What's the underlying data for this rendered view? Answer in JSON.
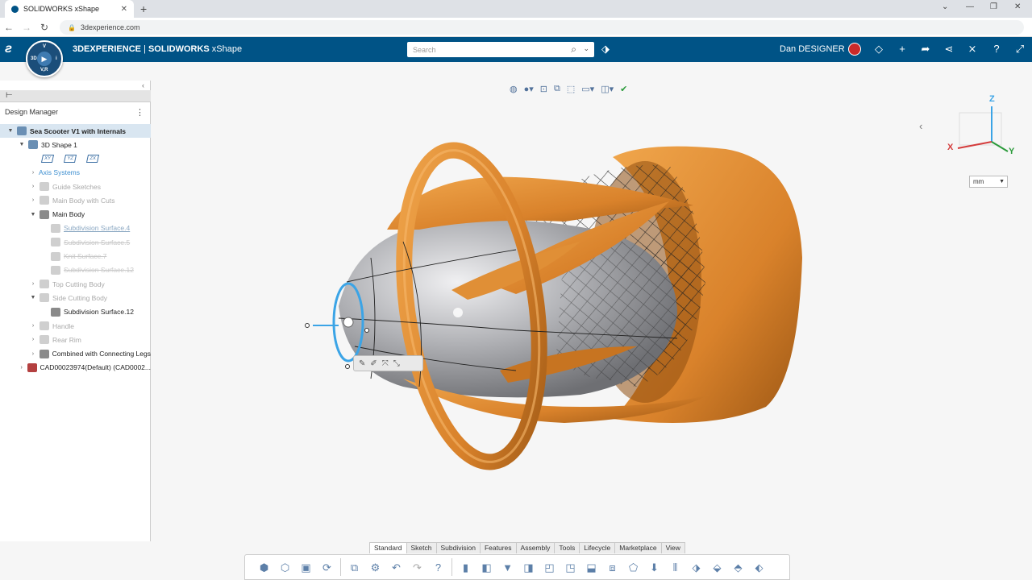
{
  "browser": {
    "tab_title": "SOLIDWORKS xShape",
    "tab_close": "✕",
    "new_tab": "+",
    "url": "3dexperience.com",
    "window_controls": [
      "⌄",
      "—",
      "❐",
      "✕"
    ]
  },
  "header": {
    "brand": "3DEXPERIENCE",
    "separator": " | ",
    "product": "SOLIDWORKS",
    "app": " xShape",
    "compass_quadrants": [
      "3D",
      "V",
      "i",
      "V,R"
    ],
    "search_placeholder": "Search",
    "user_name": "Dan DESIGNER",
    "icons": [
      "tag-icon",
      "add-icon",
      "share-icon",
      "network-icon",
      "compass-icon",
      "help-icon",
      "fullscreen-icon"
    ]
  },
  "design_manager": {
    "title": "Design Manager",
    "tree": [
      {
        "label": "Sea Scooter V1 with Internals",
        "style": "b",
        "depth": 0,
        "arrow": "▼",
        "icon": "blue",
        "selected": true
      },
      {
        "label": "3D Shape 1",
        "style": "",
        "depth": 1,
        "arrow": "▼",
        "icon": "blue"
      },
      {
        "label": "Axis Systems",
        "style": "link",
        "depth": 2,
        "arrow": "›",
        "icon": ""
      },
      {
        "label": "Guide Sketches",
        "style": "dim",
        "depth": 2,
        "arrow": "›",
        "icon": "light"
      },
      {
        "label": "Main Body with Cuts",
        "style": "dim",
        "depth": 2,
        "arrow": "›",
        "icon": "light"
      },
      {
        "label": "Main Body",
        "style": "",
        "depth": 2,
        "arrow": "▼",
        "icon": "gray"
      },
      {
        "label": "Subdivision Surface.4",
        "style": "ul",
        "depth": 3,
        "arrow": "",
        "icon": "light"
      },
      {
        "label": "Subdivision Surface.5",
        "style": "faint",
        "depth": 3,
        "arrow": "",
        "icon": "light"
      },
      {
        "label": "Knit Surface.7",
        "style": "faint",
        "depth": 3,
        "arrow": "",
        "icon": "light"
      },
      {
        "label": "Subdivision Surface.12",
        "style": "faint",
        "depth": 3,
        "arrow": "",
        "icon": "light"
      },
      {
        "label": "Top Cutting Body",
        "style": "dim",
        "depth": 2,
        "arrow": "›",
        "icon": "light"
      },
      {
        "label": "Side Cutting Body",
        "style": "dim",
        "depth": 2,
        "arrow": "▼",
        "icon": "light"
      },
      {
        "label": "Subdivision Surface.12",
        "style": "",
        "depth": 3,
        "arrow": "",
        "icon": "gray"
      },
      {
        "label": "Handle",
        "style": "dim",
        "depth": 2,
        "arrow": "›",
        "icon": "light"
      },
      {
        "label": "Rear Rim",
        "style": "dim",
        "depth": 2,
        "arrow": "›",
        "icon": "light"
      },
      {
        "label": "Combined with Connecting Legs",
        "style": "",
        "depth": 2,
        "arrow": "›",
        "icon": "gray"
      },
      {
        "label": "CAD00023974(Default) (CAD0002...",
        "style": "",
        "depth": 1,
        "arrow": "›",
        "icon": "red"
      }
    ],
    "planes": [
      "XY",
      "YZ",
      "ZX"
    ]
  },
  "viewport": {
    "triad": {
      "x": "X",
      "y": "Y",
      "z": "Z"
    },
    "units": "mm",
    "model_colors": {
      "shell": "#d9822b",
      "body": "#a9aaae",
      "selection": "#3ba4e6"
    }
  },
  "action_bar": {
    "tabs": [
      "Standard",
      "Sketch",
      "Subdivision",
      "Features",
      "Assembly",
      "Tools",
      "Lifecycle",
      "Marketplace",
      "View"
    ],
    "active_tab": "Standard"
  }
}
